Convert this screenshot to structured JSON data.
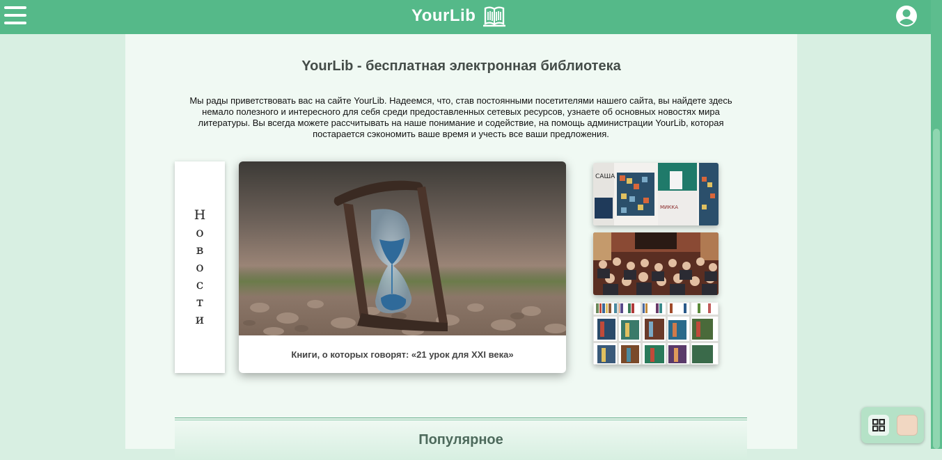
{
  "header": {
    "brand": "YourLib",
    "menu_icon": "hamburger-menu-icon",
    "logo_icon": "open-book-icon",
    "user_icon": "user-account-icon"
  },
  "main": {
    "title": "YourLib - бесплатная электронная библиотека",
    "intro": "Мы рады приветствовать вас на сайте YourLib. Надеемся, что, став постоянными посетителями нашего сайта, вы найдете здесь немало полезного и интересного для себя среди предоставленных сетевых ресурсов, узнаете об основных новостях мира литературы. Вы всегда можете рассчитывать на наше понимание и содействие, на помощь администрации YourLib, которая постарается сэкономить ваше время и учесть все ваши предложения."
  },
  "news": {
    "tab_letters": [
      "Н",
      "о",
      "в",
      "о",
      "с",
      "т",
      "и"
    ],
    "feature_caption": "Книги, о которых говорят: «21 урок для XXI века»",
    "feature_image": "hourglass-photo",
    "thumbnails": [
      "book-covers-photo",
      "reading-event-crowd-photo",
      "bookshelf-photo"
    ]
  },
  "popular": {
    "title": "Популярное"
  },
  "widget": {
    "grid_icon": "grid-icon",
    "theme_swatch_color": "#f1d7c2"
  },
  "colors": {
    "header": "#55b989",
    "page_background": "#d8efe2",
    "content_background": "#f0f9f3"
  }
}
